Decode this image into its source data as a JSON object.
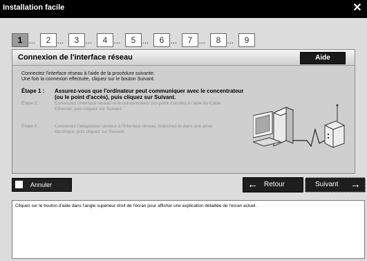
{
  "window": {
    "title": "Installation facile",
    "close_icon": "close-icon"
  },
  "steps": [
    {
      "label": "1",
      "active": true
    },
    {
      "label": "2",
      "active": false
    },
    {
      "label": "3",
      "active": false
    },
    {
      "label": "4",
      "active": false
    },
    {
      "label": "5",
      "active": false
    },
    {
      "label": "6",
      "active": false
    },
    {
      "label": "7",
      "active": false
    },
    {
      "label": "8",
      "active": false
    },
    {
      "label": "9",
      "active": false
    }
  ],
  "panel": {
    "title": "Connexion de l'interface réseau",
    "help_label": "Aide",
    "intro_line1": "Connectez l'interface réseau à l'aide de la procédure suivante.",
    "intro_line2": "Une fois la connexion effectuée, cliquez sur le bouton Suivant.",
    "step1_label": "Étape 1 :",
    "step1_line1": "Assurez-vous que l'ordinateur peut communiquer avec le concentrateur",
    "step1_line2": "(ou le point d'accès), puis cliquez sur Suivant.",
    "step2_label": "Étape 2 :",
    "step2_line1": "Connectez l'interface réseau et le concentrateur (ou point d'accès) à l'aide du Câble",
    "step2_line2": "Ethernet, puis cliquez sur Suivant.",
    "step3_label": "Étape 3 :",
    "step3_line1": "Connectez l'adaptateur secteur à l'interface réseau, branchez-le dans une prise",
    "step3_line2": "électrique, puis cliquez sur Suivant."
  },
  "buttons": {
    "cancel": "Annuler",
    "back": "Retour",
    "next": "Suivant"
  },
  "help_text": "Cliquez sur le bouton d'aide dans l'angle supérieur droit de l'écran pour afficher une explication détaillée de l'écran actuel."
}
